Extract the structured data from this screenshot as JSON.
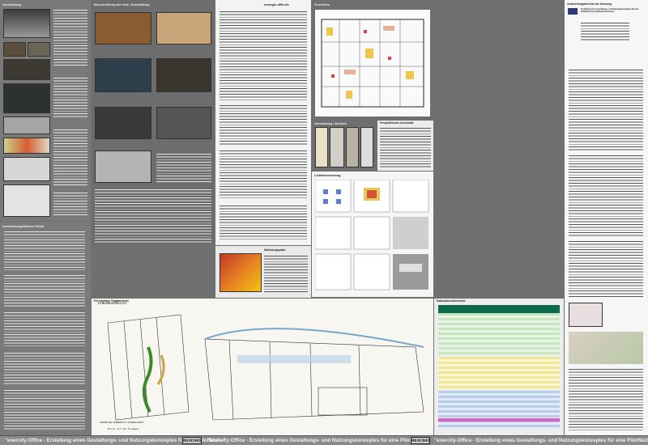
{
  "panels": {
    "p1": {
      "header": "Ausstellung"
    },
    "p2": {
      "header": "Beschreibung der tech. Ausstattung"
    },
    "p3": {
      "header": "einergie.offic.de",
      "caption_head": "Angebote der Einheiten im Raum"
    },
    "p4": {
      "header": "Grundriss"
    },
    "p5": {
      "header": "Umnutzung / Ansicht"
    },
    "p6": {
      "header": "Lichtberechnung",
      "sub": "Perspektivische Anschnitte"
    },
    "p7": {
      "header": "Nutzungsplan"
    },
    "p8": {
      "header": "Ausstellungsflächen Detail"
    },
    "p9": {
      "header": "Vorbereitungsberichte der Schulung",
      "title": "Erstellung eines Gestaltungs- und Nutzungskonzeptes für eine Pilotfläche der Stadtwerke Hannover"
    },
    "p10": {
      "header": "Perspektive Stadtansicht",
      "sketch_top": "EINGANGSANSICHT",
      "sketch_mid": "AUFENTHALTSBEREICH VERGRÖSSERT",
      "sketch_note": "Blick auf den Eingang"
    },
    "p11": {
      "header": "Kalkulationsübersicht"
    }
  },
  "footer": {
    "title": "\"enercity-Office - Erstellung eines Gestaltungs- und Nutzungskonzeptes für eine Pilotfläche\"",
    "logo": "R03C6K9"
  }
}
